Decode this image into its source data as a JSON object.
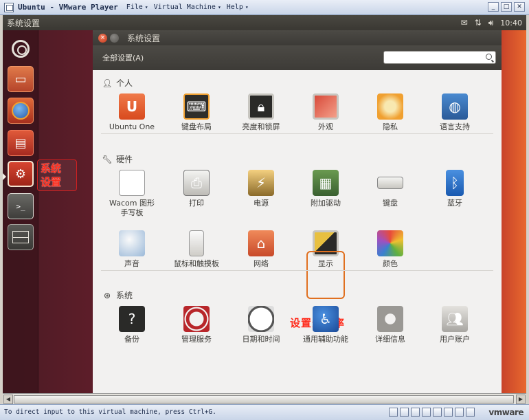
{
  "vmware": {
    "title": "Ubuntu - VMware Player",
    "menus": [
      "File",
      "Virtual Machine",
      "Help"
    ],
    "status_text": "To direct input to this virtual machine, press Ctrl+G.",
    "logo": "vmware"
  },
  "panel": {
    "app_title": "系统设置",
    "clock": "10:40",
    "indicators": [
      "mail-icon",
      "network-icon",
      "volume-icon"
    ]
  },
  "launcher": {
    "items": [
      "dash-icon",
      "files-icon",
      "firefox-icon",
      "software-center-icon",
      "system-settings-icon",
      "terminal-icon",
      "workspace-switcher-icon"
    ]
  },
  "annotations": {
    "launcher_note": "系统\n设置",
    "resolution_note": "设置分辨率"
  },
  "window": {
    "title": "系统设置",
    "all_settings": "全部设置(A)",
    "search_placeholder": ""
  },
  "sections": {
    "personal": {
      "header": "个人",
      "items": [
        {
          "label": "Ubuntu One",
          "icon": "ubuntu-one-icon"
        },
        {
          "label": "键盘布局",
          "icon": "keyboard-layout-icon"
        },
        {
          "label": "亮度和锁屏",
          "icon": "brightness-lock-icon"
        },
        {
          "label": "外观",
          "icon": "appearance-icon"
        },
        {
          "label": "隐私",
          "icon": "privacy-icon"
        },
        {
          "label": "语言支持",
          "icon": "language-icon"
        }
      ]
    },
    "hardware": {
      "header": "硬件",
      "items": [
        {
          "label": "Wacom 图形\n手写板",
          "icon": "wacom-icon"
        },
        {
          "label": "打印",
          "icon": "printer-icon"
        },
        {
          "label": "电源",
          "icon": "power-icon"
        },
        {
          "label": "附加驱动",
          "icon": "drivers-icon"
        },
        {
          "label": "键盘",
          "icon": "keyboard-icon"
        },
        {
          "label": "蓝牙",
          "icon": "bluetooth-icon"
        },
        {
          "label": "声音",
          "icon": "sound-icon"
        },
        {
          "label": "鼠标和触摸板",
          "icon": "mouse-icon"
        },
        {
          "label": "网络",
          "icon": "network-icon"
        },
        {
          "label": "显示",
          "icon": "display-icon"
        },
        {
          "label": "颜色",
          "icon": "color-icon"
        }
      ]
    },
    "system": {
      "header": "系统",
      "items": [
        {
          "label": "备份",
          "icon": "backup-icon"
        },
        {
          "label": "管理服务",
          "icon": "management-icon"
        },
        {
          "label": "日期和时间",
          "icon": "clock-icon"
        },
        {
          "label": "通用辅助功能",
          "icon": "accessibility-icon"
        },
        {
          "label": "详细信息",
          "icon": "details-icon"
        },
        {
          "label": "用户账户",
          "icon": "user-accounts-icon"
        }
      ]
    }
  }
}
